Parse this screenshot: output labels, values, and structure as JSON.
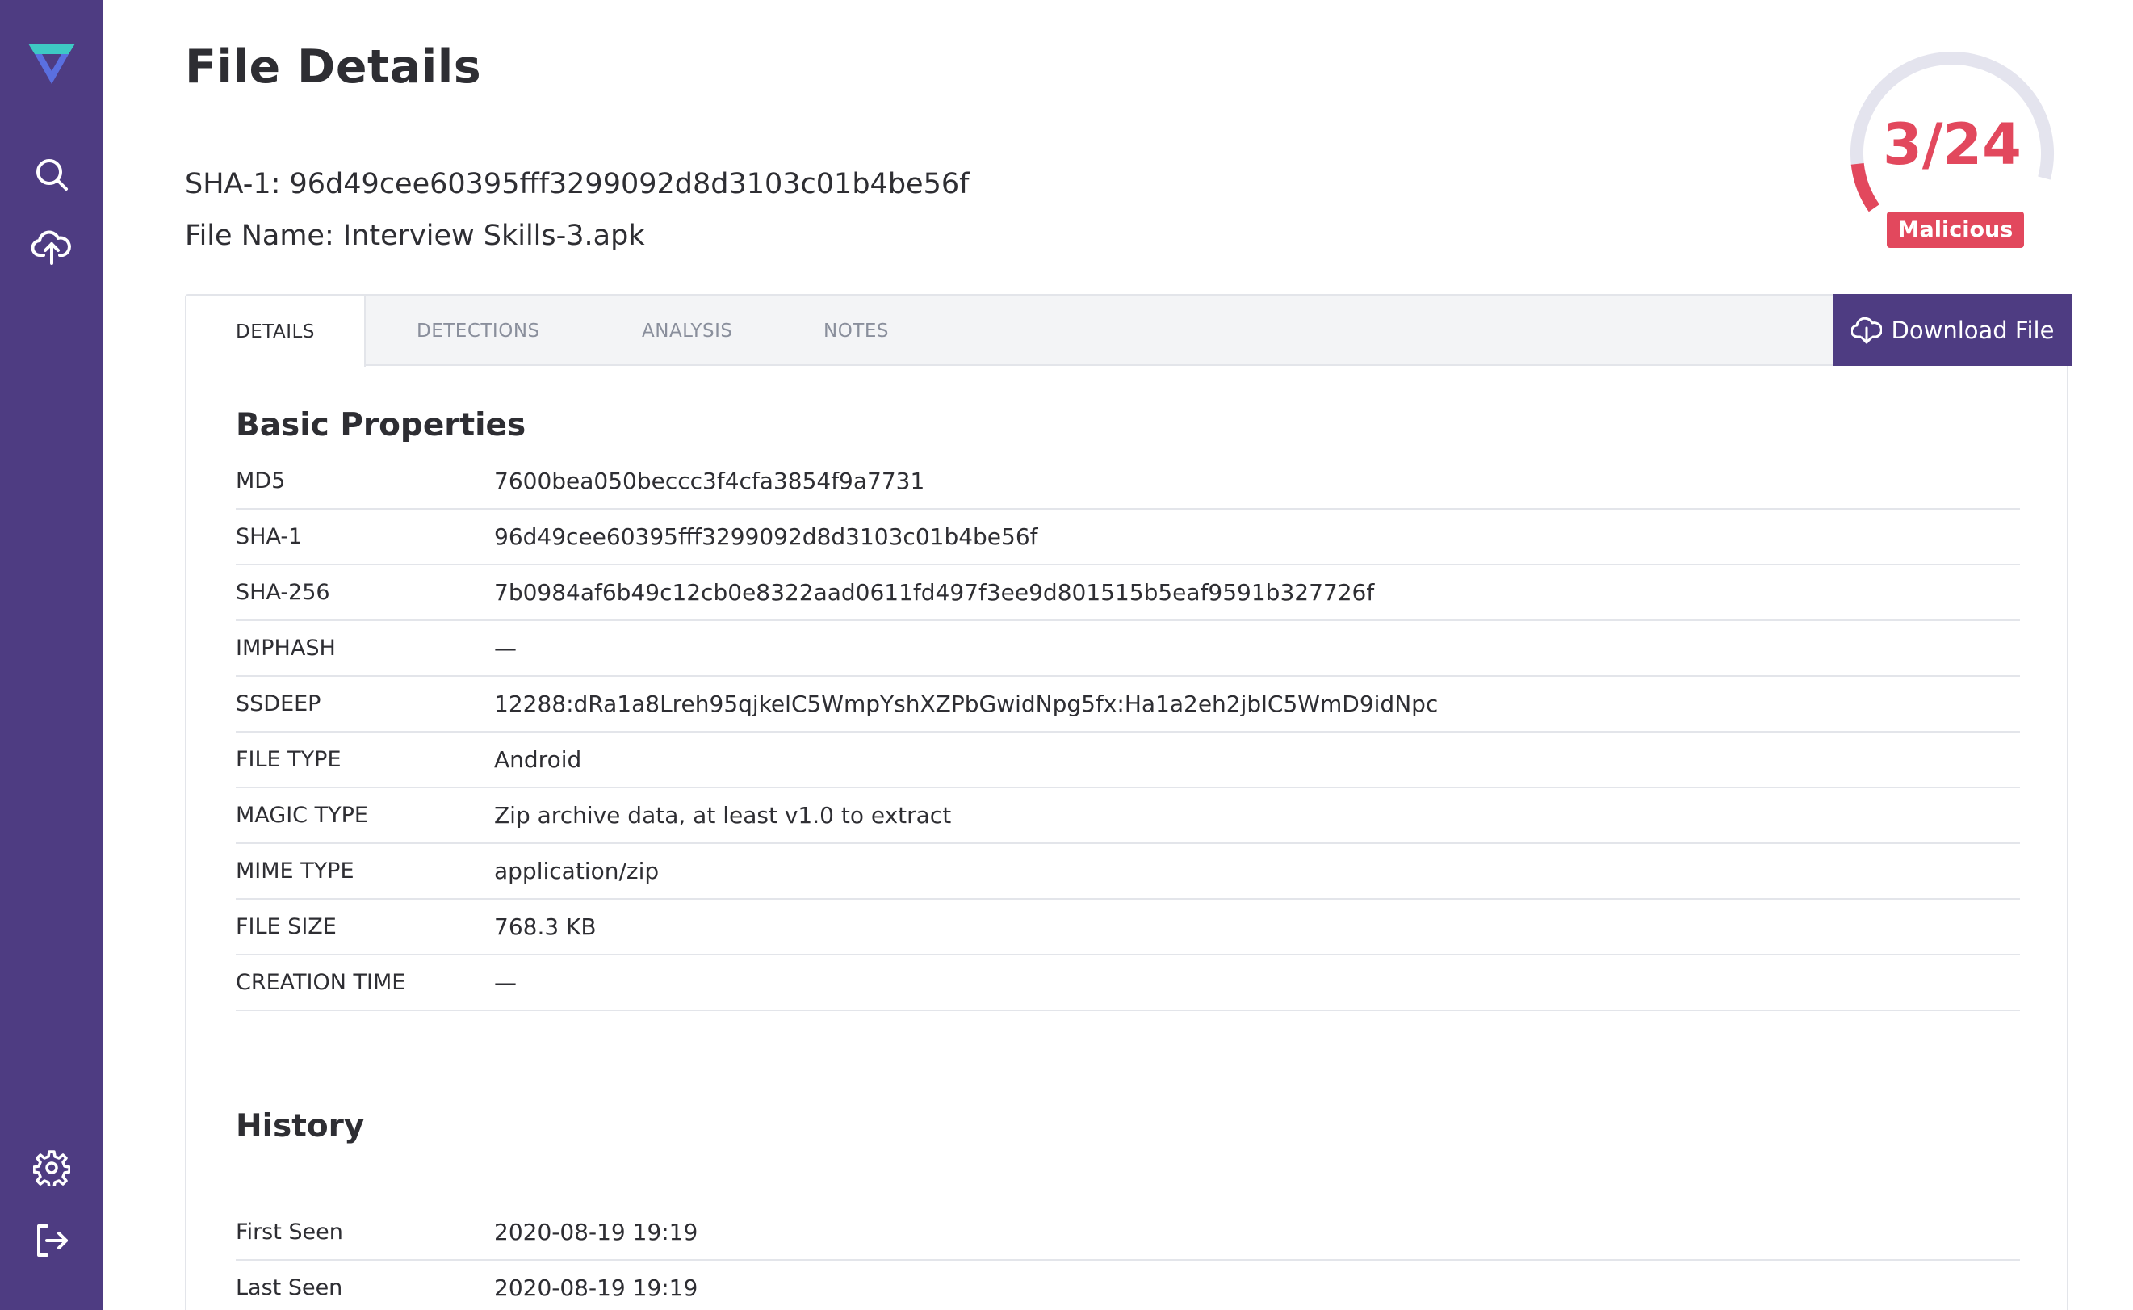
{
  "sidebar": {
    "icons": [
      "logo-icon",
      "search-icon",
      "upload-cloud-icon",
      "settings-icon",
      "logout-icon"
    ]
  },
  "page": {
    "title": "File Details",
    "sha1_line": "SHA-1: 96d49cee60395fff3299092d8d3103c01b4be56f",
    "filename_line": "File Name: Interview Skills-3.apk"
  },
  "score": {
    "text": "3/24",
    "detected": 3,
    "total": 24,
    "verdict": "Malicious",
    "color": "#e2485d"
  },
  "tabs": [
    {
      "label": "DETAILS",
      "active": true
    },
    {
      "label": "DETECTIONS",
      "active": false
    },
    {
      "label": "ANALYSIS",
      "active": false
    },
    {
      "label": "NOTES",
      "active": false
    }
  ],
  "download_label": "Download File",
  "basic": {
    "title": "Basic Properties",
    "rows": [
      {
        "key": "MD5",
        "value": "7600bea050beccc3f4cfa3854f9a7731"
      },
      {
        "key": "SHA-1",
        "value": "96d49cee60395fff3299092d8d3103c01b4be56f"
      },
      {
        "key": "SHA-256",
        "value": "7b0984af6b49c12cb0e8322aad0611fd497f3ee9d801515b5eaf9591b327726f"
      },
      {
        "key": "IMPHASH",
        "value": "—"
      },
      {
        "key": "SSDEEP",
        "value": "12288:dRa1a8Lreh95qjkelC5WmpYshXZPbGwidNpg5fx:Ha1a2eh2jblC5WmD9idNpc"
      },
      {
        "key": "FILE TYPE",
        "value": "Android"
      },
      {
        "key": "MAGIC TYPE",
        "value": "Zip archive data, at least v1.0 to extract"
      },
      {
        "key": "MIME TYPE",
        "value": "application/zip"
      },
      {
        "key": "FILE SIZE",
        "value": "768.3 KB"
      },
      {
        "key": "CREATION TIME",
        "value": "—"
      }
    ]
  },
  "history": {
    "title": "History",
    "rows": [
      {
        "key": "First Seen",
        "value": "2020-08-19 19:19"
      },
      {
        "key": "Last Seen",
        "value": "2020-08-19 19:19"
      }
    ]
  },
  "colors": {
    "sidebar": "#4e3c82",
    "accent": "#4e3c82",
    "danger": "#e2485d"
  }
}
